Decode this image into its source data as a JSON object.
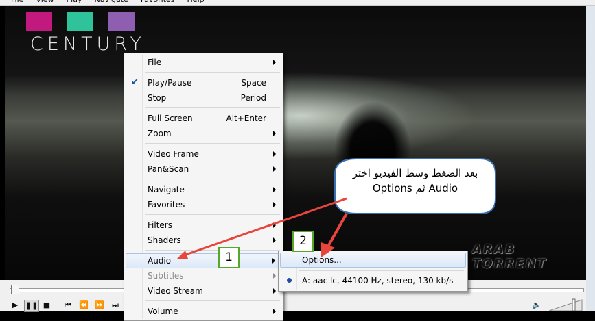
{
  "menubar": [
    "File",
    "View",
    "Play",
    "Navigate",
    "Favorites",
    "Help"
  ],
  "video": {
    "logo_text": "CENTURY",
    "logo_colors": [
      "#c1197e",
      "#2ec39a",
      "#8e5fb0"
    ],
    "watermark": "ARAB TORRENT"
  },
  "context_menu": {
    "items": [
      {
        "label": "File",
        "submenu": true
      },
      {
        "label": "Play/Pause",
        "accel": "Space",
        "checked": true
      },
      {
        "label": "Stop",
        "accel": "Period"
      },
      {
        "label": "Full Screen",
        "accel": "Alt+Enter"
      },
      {
        "label": "Zoom",
        "submenu": true
      },
      {
        "label": "Video Frame",
        "submenu": true
      },
      {
        "label": "Pan&Scan",
        "submenu": true
      },
      {
        "label": "Navigate",
        "submenu": true
      },
      {
        "label": "Favorites",
        "submenu": true
      },
      {
        "label": "Filters",
        "submenu": true
      },
      {
        "label": "Shaders",
        "submenu": true
      },
      {
        "label": "Audio",
        "submenu": true,
        "highlighted": true
      },
      {
        "label": "Subtitles",
        "submenu": true,
        "disabled": true
      },
      {
        "label": "Video Stream",
        "submenu": true
      },
      {
        "label": "Volume",
        "submenu": true
      }
    ]
  },
  "audio_submenu": {
    "options_label": "Options...",
    "stream_label": "A: aac lc, 44100 Hz, stereo, 130 kb/s"
  },
  "annotations": {
    "step1": "1",
    "step2": "2",
    "callout_line1": "بعد الضغط وسط الفيديو اختر",
    "callout_line2": "Audio ثم Options",
    "callout_border": "#3a6fb0",
    "arrow_color": "#e8453c",
    "step_border": "#57a72a"
  },
  "controls": {
    "play_icon": "▶",
    "pause_icon": "❚❚",
    "stop_icon": "■",
    "prev_icon": "⏮",
    "rew_icon": "⏪",
    "fwd_icon": "⏩",
    "next_icon": "⏭",
    "volume_icon": "🔈"
  }
}
